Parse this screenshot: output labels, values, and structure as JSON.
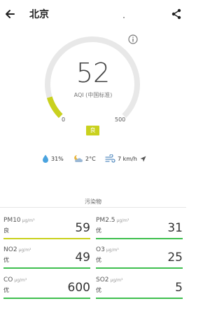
{
  "header": {
    "city": "北京"
  },
  "aqi": {
    "value": "52",
    "standard": "AQI (中国标准)",
    "min": "0",
    "max": "500",
    "level": "良",
    "fraction": 0.104
  },
  "weather": {
    "humidity": "31%",
    "temperature": "2°C",
    "wind": "7 km/h"
  },
  "pollutants_title": "污染物",
  "pollutants": [
    {
      "name": "PM10",
      "unit": "µg/m³",
      "level": "良",
      "value": "59",
      "color": "#c9d11e"
    },
    {
      "name": "PM2.5",
      "unit": "µg/m³",
      "level": "优",
      "value": "31",
      "color": "#3fbf4f"
    },
    {
      "name": "NO2",
      "unit": "µg/m³",
      "level": "优",
      "value": "49",
      "color": "#3fbf4f"
    },
    {
      "name": "O3",
      "unit": "µg/m³",
      "level": "优",
      "value": "25",
      "color": "#3fbf4f"
    },
    {
      "name": "CO",
      "unit": "µg/m³",
      "level": "优",
      "value": "600",
      "color": "#3fbf4f"
    },
    {
      "name": "SO2",
      "unit": "µg/m³",
      "level": "优",
      "value": "5",
      "color": "#3fbf4f"
    }
  ],
  "colors": {
    "good": "#3fbf4f",
    "moderate": "#c9d11e",
    "track": "#e8e8e8"
  }
}
